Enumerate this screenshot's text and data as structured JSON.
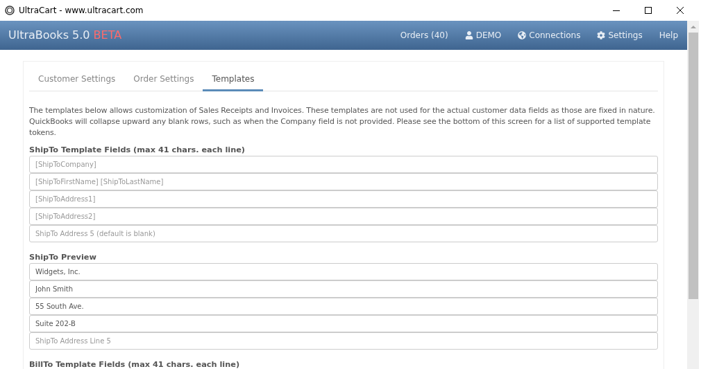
{
  "window": {
    "title": "UltraCart - www.ultracart.com"
  },
  "navbar": {
    "brand": "UltraBooks 5.0",
    "badge": "BETA",
    "links": [
      {
        "label": "Orders (40)",
        "kind": "text"
      },
      {
        "label": "DEMO",
        "kind": "user"
      },
      {
        "label": "Connections",
        "kind": "connections"
      },
      {
        "label": "Settings",
        "kind": "settings"
      },
      {
        "label": "Help",
        "kind": "text"
      }
    ]
  },
  "tabs": [
    {
      "label": "Customer Settings",
      "selected": false
    },
    {
      "label": "Order Settings",
      "selected": false
    },
    {
      "label": "Templates",
      "selected": true
    }
  ],
  "intro": "The templates below allows customization of Sales Receipts and Invoices. These templates are not used for the actual customer data fields as those are fixed in nature. QuickBooks will collapse upward any blank rows, such as when the Company field is not provided. Please see the bottom of this screen for a list of supported template tokens.",
  "sections": [
    {
      "heading": "ShipTo Template Fields (max 41 chars. each line)",
      "fields": [
        {
          "placeholder": "[ShipToCompany]"
        },
        {
          "placeholder": "[ShipToFirstName] [ShipToLastName]"
        },
        {
          "placeholder": "[ShipToAddress1]"
        },
        {
          "placeholder": "[ShipToAddress2]"
        },
        {
          "placeholder": "ShipTo Address 5 (default is blank)"
        }
      ]
    },
    {
      "heading": "ShipTo Preview",
      "fields": [
        {
          "value": "Widgets, Inc."
        },
        {
          "value": "John Smith"
        },
        {
          "value": "55 South Ave."
        },
        {
          "value": "Suite 202-B"
        },
        {
          "placeholder": "ShipTo Address Line 5"
        }
      ]
    },
    {
      "heading": "BillTo Template Fields (max 41 chars. each line)"
    }
  ]
}
